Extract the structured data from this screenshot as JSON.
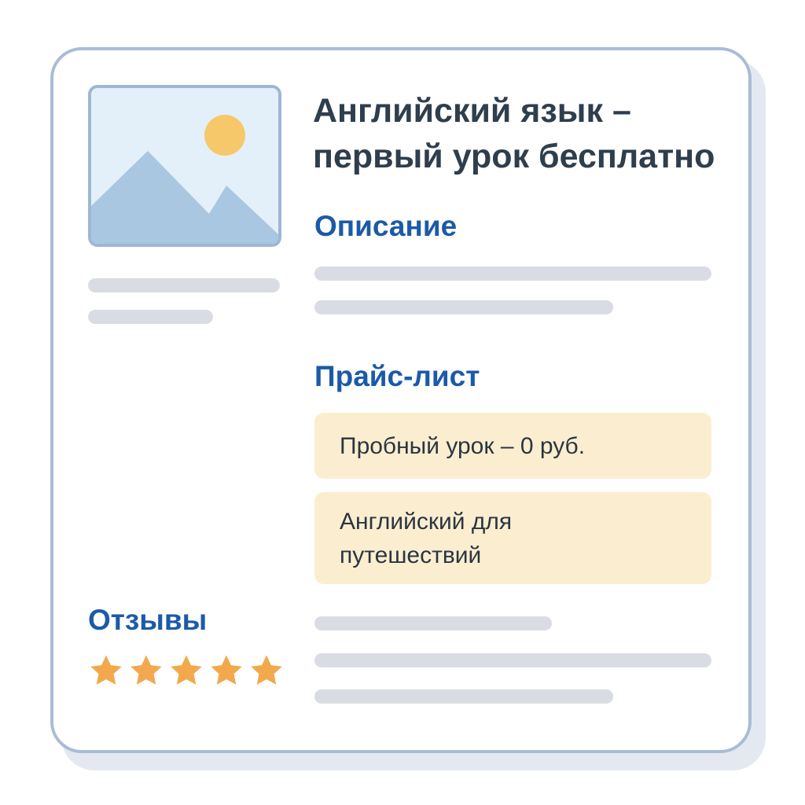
{
  "listing": {
    "title": "Английский язык – первый урок бесплатно"
  },
  "sections": {
    "description_heading": "Описание",
    "pricelist_heading": "Прайс-лист",
    "reviews_heading": "Отзывы"
  },
  "pricelist": {
    "items": [
      {
        "label": "Пробный урок – 0 руб."
      },
      {
        "label": "Английский для путешествий"
      }
    ]
  },
  "reviews": {
    "rating": 5,
    "max_rating": 5,
    "star_color": "#f2a94e"
  },
  "icons": {
    "photo_placeholder": "image-placeholder-icon",
    "star": "star-icon"
  },
  "colors": {
    "heading_accent": "#1c5aa8",
    "title_text": "#2f3e4d",
    "price_background": "#fbeed0",
    "card_border": "#a8bcd6",
    "skeleton": "#d9dde3"
  }
}
